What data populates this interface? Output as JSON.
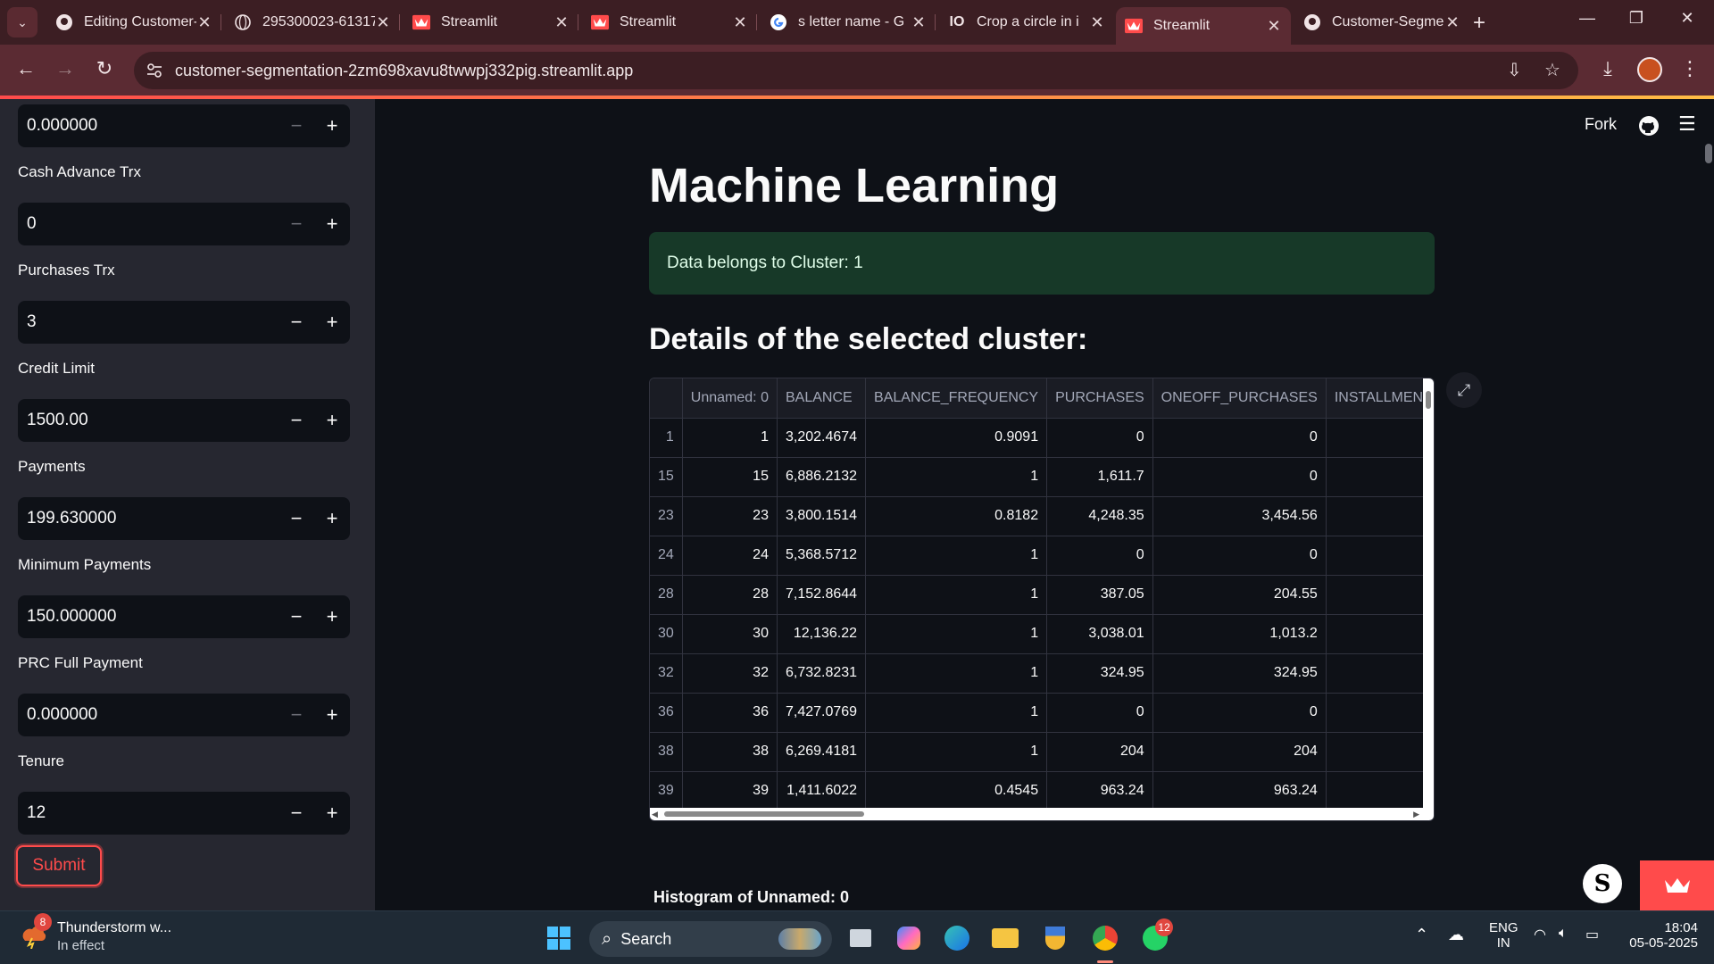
{
  "browser": {
    "tabs": [
      {
        "label": "Editing Customer-",
        "favicon": "github-icon"
      },
      {
        "label": "295300023-61317",
        "favicon": "globe-icon"
      },
      {
        "label": "Streamlit",
        "favicon": "streamlit-icon"
      },
      {
        "label": "Streamlit",
        "favicon": "streamlit-icon"
      },
      {
        "label": "s letter name - G",
        "favicon": "google-icon"
      },
      {
        "label": "Crop a circle in i",
        "favicon": "io-icon"
      },
      {
        "label": "Streamlit",
        "favicon": "streamlit-icon",
        "active": true
      },
      {
        "label": "Customer-Segme",
        "favicon": "github-icon"
      }
    ],
    "tab_close": "✕",
    "new_tab": "+",
    "url": "customer-segmentation-2zm698xavu8twwpj332pig.streamlit.app"
  },
  "sidebar": {
    "fields": [
      {
        "label": "",
        "value": "0.000000",
        "minus_disabled": true
      },
      {
        "label": "Cash Advance Trx",
        "value": "0",
        "minus_disabled": true
      },
      {
        "label": "Purchases Trx",
        "value": "3",
        "minus_disabled": false
      },
      {
        "label": "Credit Limit",
        "value": "1500.00",
        "minus_disabled": false
      },
      {
        "label": "Payments",
        "value": "199.630000",
        "minus_disabled": false
      },
      {
        "label": "Minimum Payments",
        "value": "150.000000",
        "minus_disabled": false
      },
      {
        "label": "PRC Full Payment",
        "value": "0.000000",
        "minus_disabled": true
      },
      {
        "label": "Tenure",
        "value": "12",
        "minus_disabled": false
      }
    ],
    "minus": "−",
    "plus": "+",
    "submit_label": "Submit"
  },
  "main": {
    "fork_label": "Fork",
    "title": "Machine Learning",
    "alert_text": "Data belongs to Cluster: 1",
    "subheader": "Details of the selected cluster:",
    "table": {
      "columns": [
        "",
        "Unnamed: 0",
        "BALANCE",
        "BALANCE_FREQUENCY",
        "PURCHASES",
        "ONEOFF_PURCHASES",
        "INSTALLMENTS"
      ],
      "rows": [
        [
          "1",
          "1",
          "3,202.4674",
          "0.9091",
          "0",
          "0",
          ""
        ],
        [
          "15",
          "15",
          "6,886.2132",
          "1",
          "1,611.7",
          "0",
          ""
        ],
        [
          "23",
          "23",
          "3,800.1514",
          "0.8182",
          "4,248.35",
          "3,454.56",
          ""
        ],
        [
          "24",
          "24",
          "5,368.5712",
          "1",
          "0",
          "0",
          ""
        ],
        [
          "28",
          "28",
          "7,152.8644",
          "1",
          "387.05",
          "204.55",
          ""
        ],
        [
          "30",
          "30",
          "12,136.22",
          "1",
          "3,038.01",
          "1,013.2",
          ""
        ],
        [
          "32",
          "32",
          "6,732.8231",
          "1",
          "324.95",
          "324.95",
          ""
        ],
        [
          "36",
          "36",
          "7,427.0769",
          "1",
          "0",
          "0",
          ""
        ],
        [
          "38",
          "38",
          "6,269.4181",
          "1",
          "204",
          "204",
          ""
        ],
        [
          "39",
          "39",
          "1,411.6022",
          "0.4545",
          "963.24",
          "963.24",
          ""
        ]
      ]
    },
    "histogram_title": "Histogram of Unnamed: 0",
    "badge_letter": "S"
  },
  "taskbar": {
    "weather_title": "Thunderstorm w...",
    "weather_sub": "In effect",
    "weather_badge": "8",
    "search_label": "Search",
    "whatsapp_badge": "12",
    "lang_line1": "ENG",
    "lang_line2": "IN",
    "time": "18:04",
    "date": "05-05-2025"
  },
  "colors": {
    "accent": "#ff4b4b",
    "alert_bg": "#173928",
    "sidebar_bg": "#262730",
    "app_bg": "#0e1117",
    "chrome_bg": "#3c1e23"
  }
}
